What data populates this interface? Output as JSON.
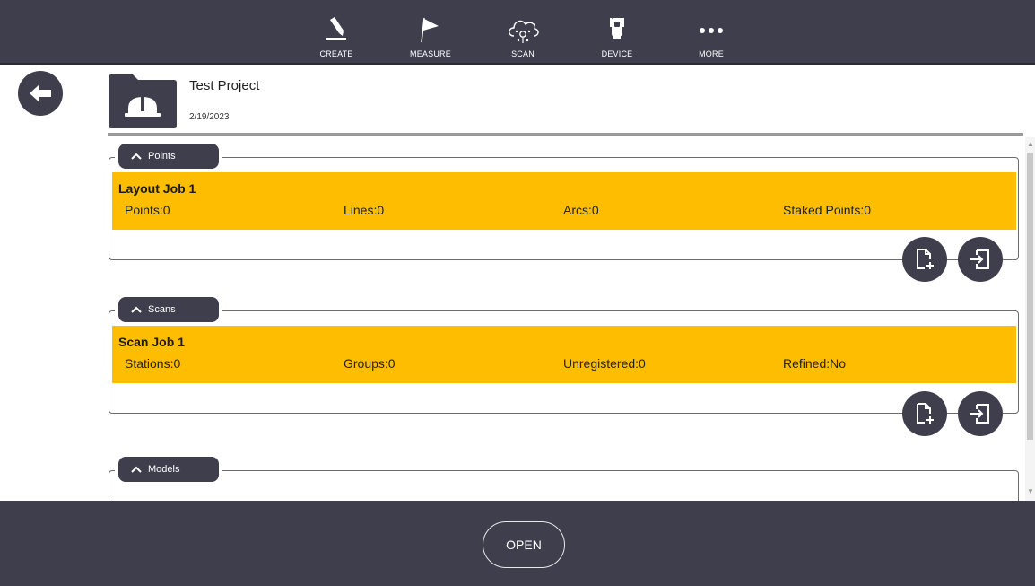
{
  "toolbar": {
    "items": [
      {
        "label": "CREATE",
        "icon": "pencil-icon"
      },
      {
        "label": "MEASURE",
        "icon": "flag-icon"
      },
      {
        "label": "SCAN",
        "icon": "scan-cloud-icon"
      },
      {
        "label": "DEVICE",
        "icon": "device-icon"
      },
      {
        "label": "MORE",
        "icon": "more-dots-icon"
      }
    ]
  },
  "project": {
    "name": "Test Project",
    "date": "2/19/2023"
  },
  "sections": {
    "points": {
      "tab_label": "Points",
      "job": {
        "title": "Layout Job 1",
        "stats": [
          "Points:0",
          "Lines:0",
          "Arcs:0",
          "Staked Points:0"
        ]
      }
    },
    "scans": {
      "tab_label": "Scans",
      "job": {
        "title": "Scan Job 1",
        "stats": [
          "Stations:0",
          "Groups:0",
          "Unregistered:0",
          "Refined:No"
        ]
      }
    },
    "models": {
      "tab_label": "Models"
    }
  },
  "footer": {
    "open_label": "OPEN"
  },
  "colors": {
    "toolbar_bg": "#3f3e4d",
    "job_highlight": "#ffbd00"
  }
}
